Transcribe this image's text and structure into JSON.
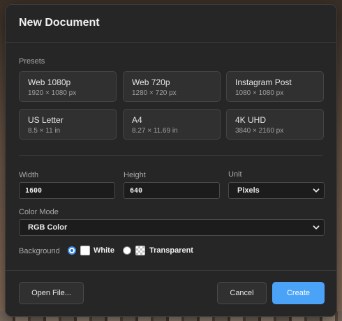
{
  "dialog": {
    "title": "New Document"
  },
  "presets": {
    "label": "Presets",
    "items": [
      {
        "name": "Web 1080p",
        "size": "1920 × 1080 px"
      },
      {
        "name": "Web 720p",
        "size": "1280 × 720 px"
      },
      {
        "name": "Instagram Post",
        "size": "1080 × 1080 px"
      },
      {
        "name": "US Letter",
        "size": "8.5 × 11 in"
      },
      {
        "name": "A4",
        "size": "8.27 × 11.69 in"
      },
      {
        "name": "4K UHD",
        "size": "3840 × 2160 px"
      }
    ]
  },
  "dimensions": {
    "width_label": "Width",
    "width_value": "1600",
    "height_label": "Height",
    "height_value": "640",
    "unit_label": "Unit",
    "unit_value": "Pixels"
  },
  "color_mode": {
    "label": "Color Mode",
    "value": "RGB Color"
  },
  "background": {
    "label": "Background",
    "options": [
      {
        "label": "White",
        "selected": true
      },
      {
        "label": "Transparent",
        "selected": false
      }
    ]
  },
  "buttons": {
    "open_file": "Open File...",
    "cancel": "Cancel",
    "create": "Create"
  },
  "colors": {
    "dialog_bg": "#262626",
    "accent": "#4ba3f7",
    "radio_selected": "#3d8ef0"
  },
  "icons": {
    "select_chevron": "chevron-down-icon"
  }
}
